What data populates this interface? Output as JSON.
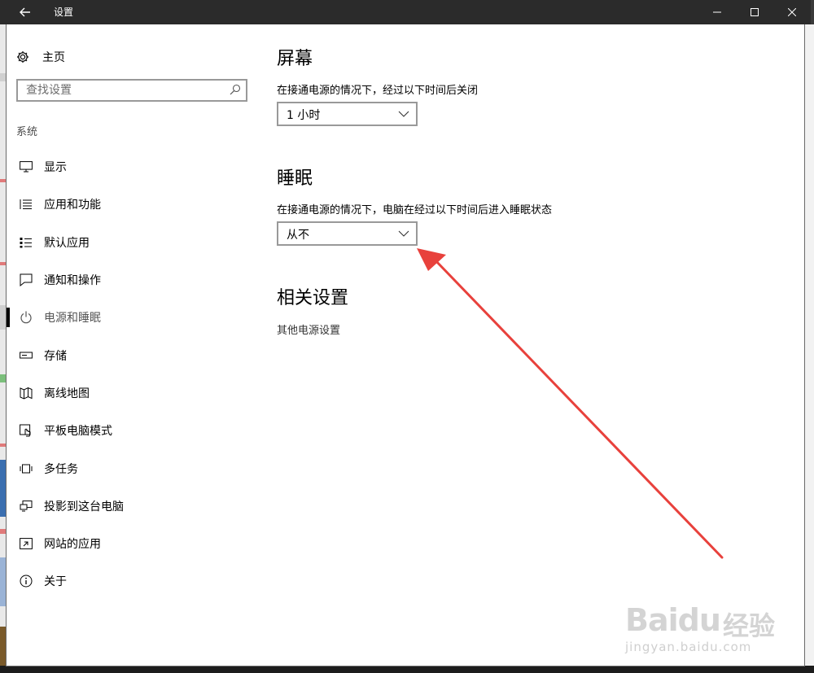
{
  "window": {
    "title": "设置"
  },
  "sidebar": {
    "home_label": "主页",
    "search_placeholder": "查找设置",
    "section_label": "系统",
    "items": [
      {
        "label": "显示",
        "icon": "monitor-icon"
      },
      {
        "label": "应用和功能",
        "icon": "list-icon"
      },
      {
        "label": "默认应用",
        "icon": "default-apps-icon"
      },
      {
        "label": "通知和操作",
        "icon": "notification-icon"
      },
      {
        "label": "电源和睡眠",
        "icon": "power-icon",
        "active": true
      },
      {
        "label": "存储",
        "icon": "storage-icon"
      },
      {
        "label": "离线地图",
        "icon": "map-icon"
      },
      {
        "label": "平板电脑模式",
        "icon": "tablet-icon"
      },
      {
        "label": "多任务",
        "icon": "multitask-icon"
      },
      {
        "label": "投影到这台电脑",
        "icon": "project-icon"
      },
      {
        "label": "网站的应用",
        "icon": "web-apps-icon"
      },
      {
        "label": "关于",
        "icon": "info-icon"
      }
    ]
  },
  "content": {
    "screen": {
      "heading": "屏幕",
      "description": "在接通电源的情况下，经过以下时间后关闭",
      "selected": "1 小时"
    },
    "sleep": {
      "heading": "睡眠",
      "description": "在接通电源的情况下，电脑在经过以下时间后进入睡眠状态",
      "selected": "从不"
    },
    "related": {
      "heading": "相关设置",
      "link": "其他电源设置"
    }
  },
  "watermark": {
    "logo": "Baidu",
    "cn": "经验",
    "url": "jingyan.baidu.com"
  },
  "colors": {
    "titlebar": "#2b2b2b",
    "annotation_arrow": "#e8413c",
    "field_border": "#999999"
  }
}
